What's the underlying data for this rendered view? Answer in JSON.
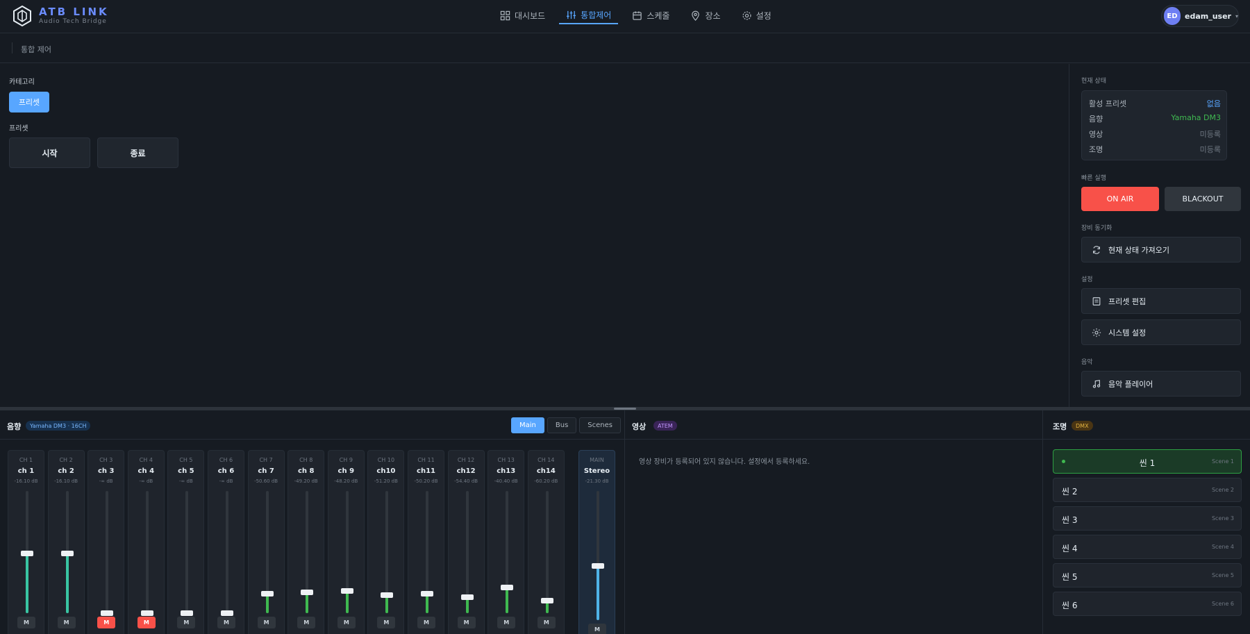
{
  "brand": {
    "title": "ATB LINK",
    "subtitle": "Audio Tech Bridge"
  },
  "nav": [
    {
      "label": "대시보드",
      "icon": "grid-icon",
      "active": false
    },
    {
      "label": "통합제어",
      "icon": "sliders-icon",
      "active": true
    },
    {
      "label": "스케줄",
      "icon": "calendar-icon",
      "active": false
    },
    {
      "label": "장소",
      "icon": "map-pin-icon",
      "active": false
    },
    {
      "label": "설정",
      "icon": "gear-icon",
      "active": false
    }
  ],
  "user": {
    "initials": "ED",
    "name": "edam_user"
  },
  "breadcrumb": "통합 제어",
  "left": {
    "category_label": "카테고리",
    "category_button": "프리셋",
    "preset_label": "프리셋",
    "presets": [
      "시작",
      "종료"
    ]
  },
  "right": {
    "status_title": "현재 상태",
    "status": [
      {
        "key": "활성 프리셋",
        "value": "없음",
        "color": "#58a6ff"
      },
      {
        "key": "음향",
        "value": "Yamaha DM3",
        "color": "#3fb950"
      },
      {
        "key": "영상",
        "value": "미등록",
        "color": "#6e7681"
      },
      {
        "key": "조명",
        "value": "미등록",
        "color": "#6e7681"
      }
    ],
    "quick_title": "빠른 실행",
    "on_air": "ON AIR",
    "blackout": "BLACKOUT",
    "sync_title": "장비 동기화",
    "sync_button": "현재 상태 가져오기",
    "settings_title": "설정",
    "preset_edit": "프리셋 편집",
    "system_settings": "시스템 설정",
    "music_title": "음악",
    "music_player": "음악 플레이어"
  },
  "audio": {
    "title": "음향",
    "badge": "Yamaha DM3 · 16CH",
    "tabs": [
      "Main",
      "Bus",
      "Scenes"
    ],
    "active_tab": "Main",
    "mute_label": "M",
    "channels": [
      {
        "num": "CH 1",
        "name": "ch 1",
        "db": "-16.10 dB",
        "level": 0.49,
        "muted": false
      },
      {
        "num": "CH 2",
        "name": "ch 2",
        "db": "-16.10 dB",
        "level": 0.49,
        "muted": false
      },
      {
        "num": "CH 3",
        "name": "ch 3",
        "db": "-∞ dB",
        "level": 0.0,
        "muted": true
      },
      {
        "num": "CH 4",
        "name": "ch 4",
        "db": "-∞ dB",
        "level": 0.0,
        "muted": true
      },
      {
        "num": "CH 5",
        "name": "ch 5",
        "db": "-∞ dB",
        "level": 0.0,
        "muted": false
      },
      {
        "num": "CH 6",
        "name": "ch 6",
        "db": "-∞ dB",
        "level": 0.0,
        "muted": false
      },
      {
        "num": "CH 7",
        "name": "ch 7",
        "db": "-50.60 dB",
        "level": 0.16,
        "muted": false
      },
      {
        "num": "CH 8",
        "name": "ch 8",
        "db": "-49.20 dB",
        "level": 0.17,
        "muted": false
      },
      {
        "num": "CH 9",
        "name": "ch 9",
        "db": "-48.20 dB",
        "level": 0.18,
        "muted": false
      },
      {
        "num": "CH 10",
        "name": "ch10",
        "db": "-51.20 dB",
        "level": 0.15,
        "muted": false
      },
      {
        "num": "CH 11",
        "name": "ch11",
        "db": "-50.20 dB",
        "level": 0.16,
        "muted": false
      },
      {
        "num": "CH 12",
        "name": "ch12",
        "db": "-54.40 dB",
        "level": 0.13,
        "muted": false
      },
      {
        "num": "CH 13",
        "name": "ch13",
        "db": "-40.40 dB",
        "level": 0.21,
        "muted": false
      },
      {
        "num": "CH 14",
        "name": "ch14",
        "db": "-60.20 dB",
        "level": 0.1,
        "muted": false
      }
    ],
    "master": {
      "num": "MAIN",
      "name": "Stereo",
      "db": "-21.30 dB",
      "level": 0.42
    }
  },
  "video": {
    "title": "영상",
    "badge": "ATEM",
    "empty_message": "영상 장비가 등록되어 있지 않습니다. 설정에서 등록하세요."
  },
  "lighting": {
    "title": "조명",
    "badge": "DMX",
    "scenes": [
      {
        "name": "씬 1",
        "sub": "Scene 1",
        "active": true
      },
      {
        "name": "씬 2",
        "sub": "Scene 2",
        "active": false
      },
      {
        "name": "씬 3",
        "sub": "Scene 3",
        "active": false
      },
      {
        "name": "씬 4",
        "sub": "Scene 4",
        "active": false
      },
      {
        "name": "씬 5",
        "sub": "Scene 5",
        "active": false
      },
      {
        "name": "씬 6",
        "sub": "Scene 6",
        "active": false
      }
    ]
  },
  "colors": {
    "accent": "#58a6ff",
    "on_air": "#f85149",
    "ok": "#3fb950",
    "brand": "#6b8cff",
    "master_fill": "#4fb3e8",
    "ch_fill_high": "#39c5a3"
  }
}
